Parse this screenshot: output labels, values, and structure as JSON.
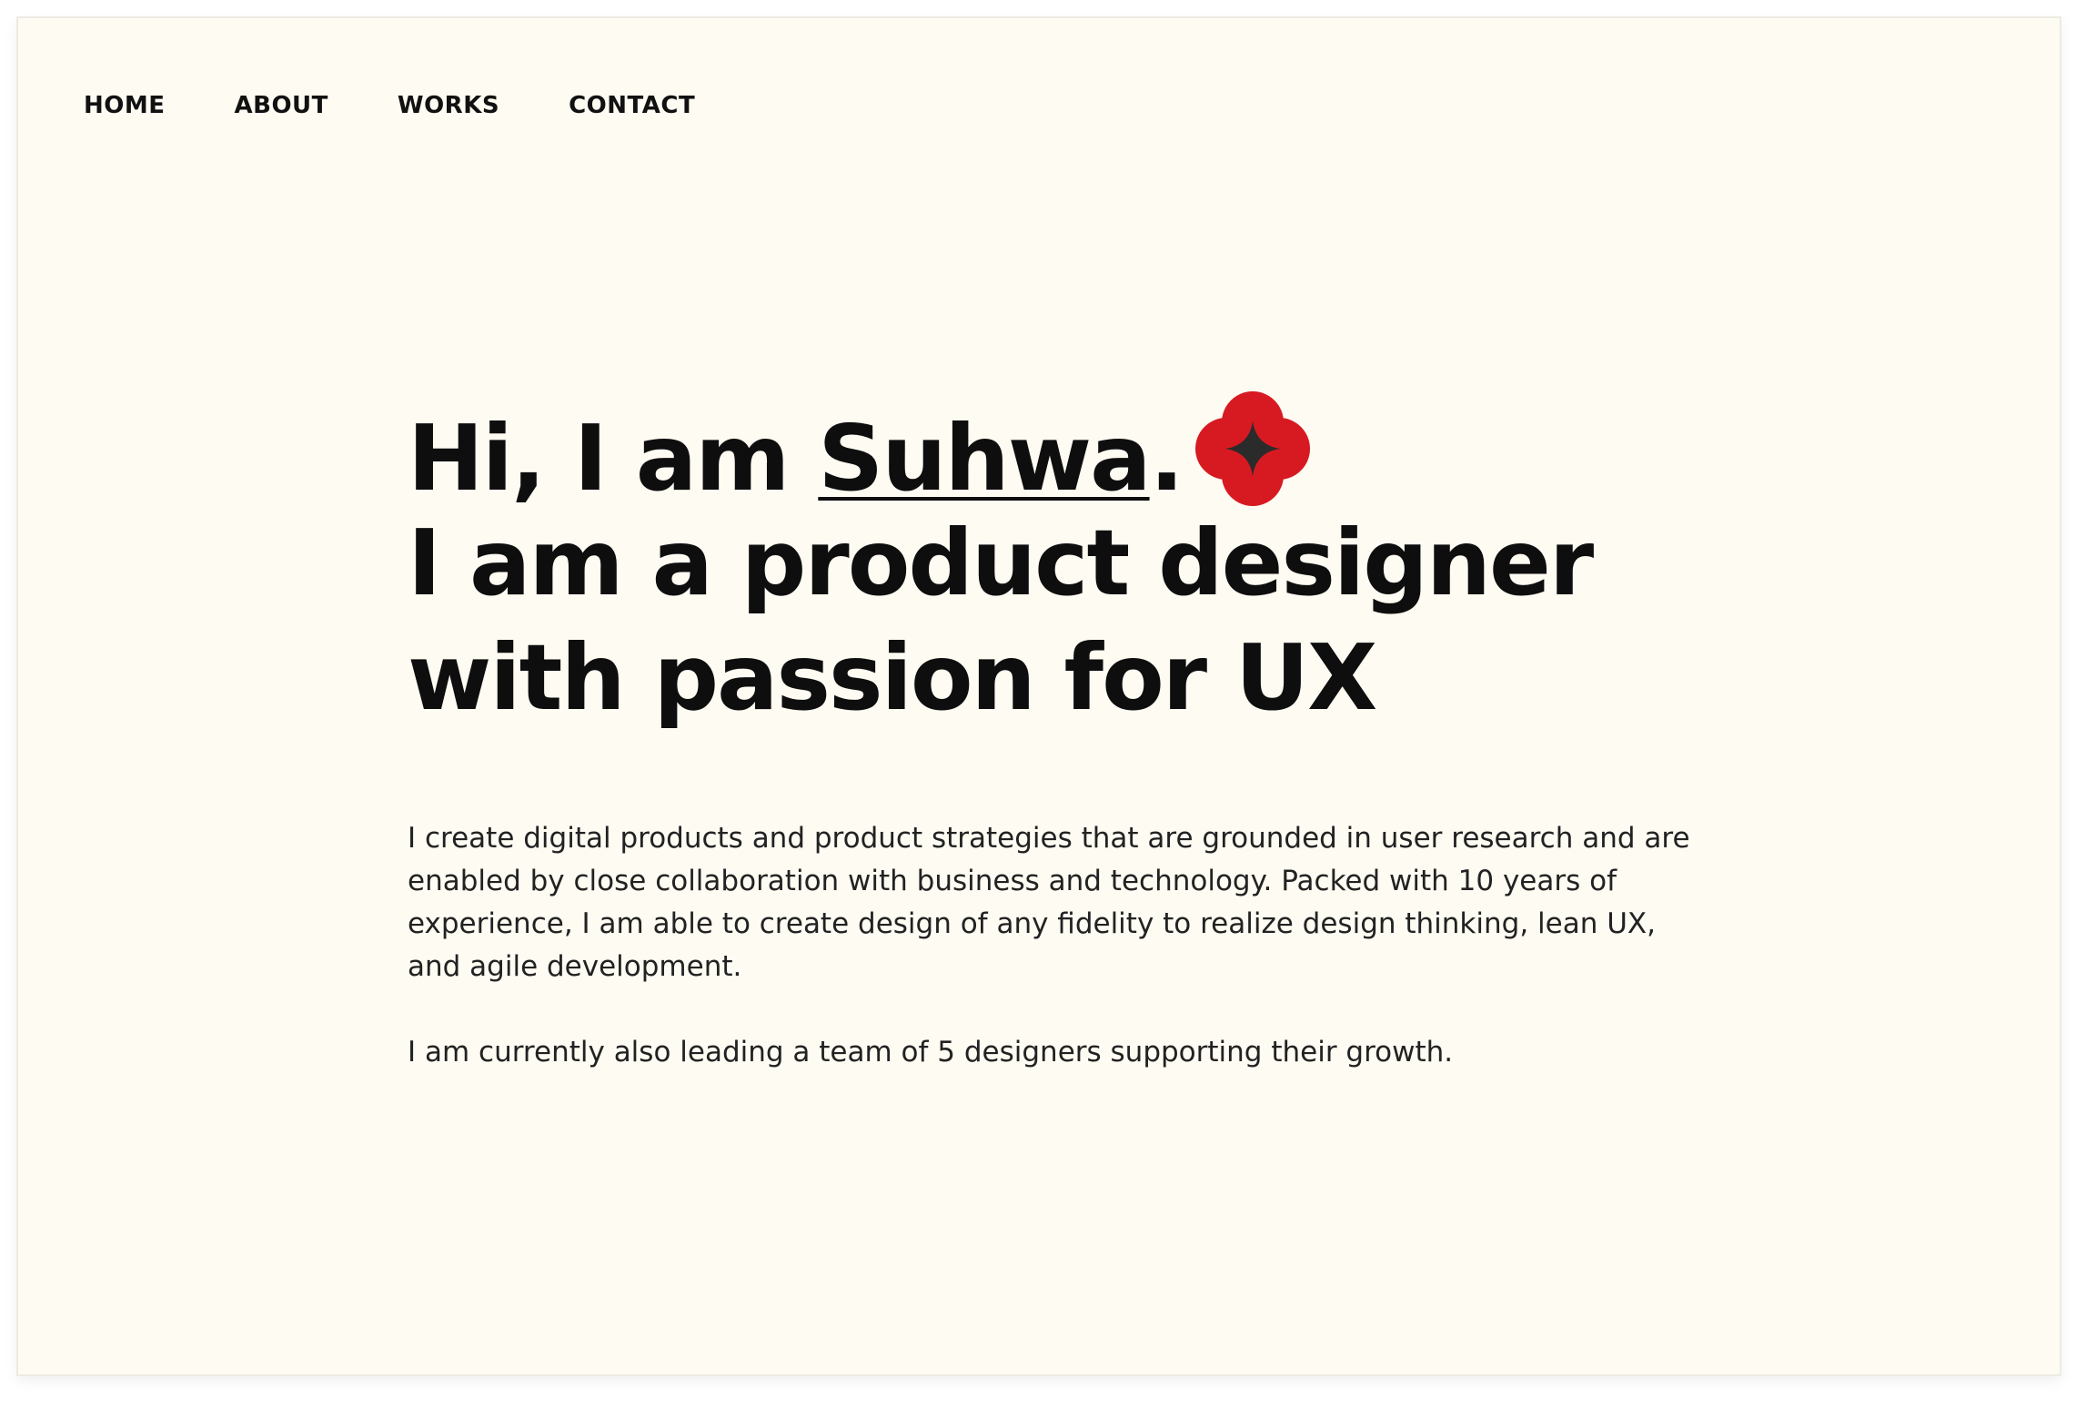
{
  "nav": {
    "items": [
      {
        "label": "HOME"
      },
      {
        "label": "ABOUT"
      },
      {
        "label": "WORKS"
      },
      {
        "label": "CONTACT"
      }
    ]
  },
  "hero": {
    "greeting_prefix": "Hi, I am ",
    "name": "Suhwa",
    "greeting_suffix": ".",
    "line2": "I am a product designer",
    "line3": "with passion for UX",
    "icon": "four-petal-flower-icon",
    "icon_color": "#d71a21",
    "icon_center_color": "#2b2b2b"
  },
  "bio": {
    "paragraph1": "I create digital products and product strategies that are grounded in user research and are enabled by close collaboration with business and technology. Packed with 10 years of experience, I am able to create design of any fidelity to realize design thinking, lean UX, and agile development.",
    "paragraph2": "I am currently also leading a team of 5 designers supporting their growth."
  },
  "colors": {
    "background": "#fdfbf2",
    "text": "#0e0e0e",
    "accent": "#d71a21"
  }
}
